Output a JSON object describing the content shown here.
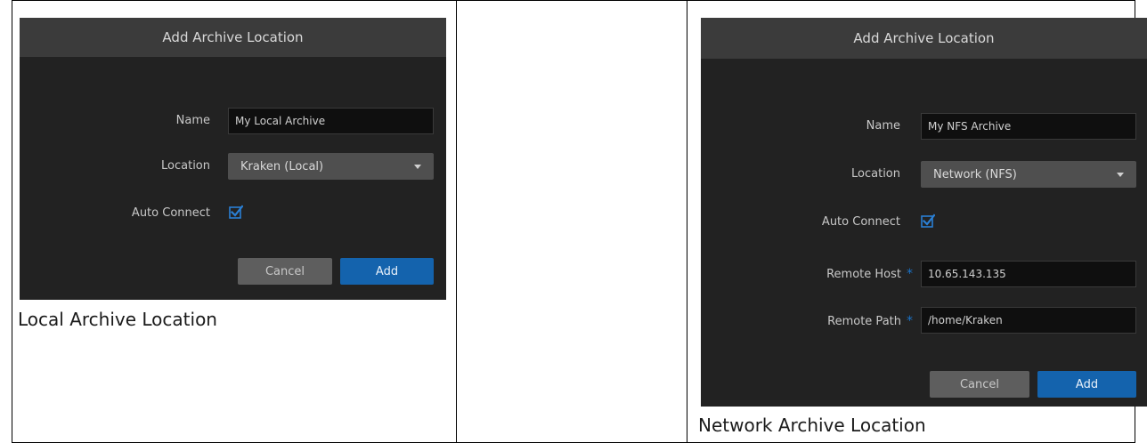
{
  "local": {
    "title": "Add Archive Location",
    "name_label": "Name",
    "name_value": "My Local Archive",
    "location_label": "Location",
    "location_value": "Kraken (Local)",
    "autoconnect_label": "Auto Connect",
    "autoconnect_checked": true,
    "cancel_label": "Cancel",
    "add_label": "Add",
    "caption": "Local Archive Location"
  },
  "network": {
    "title": "Add Archive Location",
    "name_label": "Name",
    "name_value": "My NFS Archive",
    "location_label": "Location",
    "location_value": "Network (NFS)",
    "autoconnect_label": "Auto Connect",
    "autoconnect_checked": true,
    "remote_host_label": "Remote Host",
    "remote_host_value": "10.65.143.135",
    "remote_path_label": "Remote Path",
    "remote_path_value": "/home/Kraken",
    "required_marker": "*",
    "cancel_label": "Cancel",
    "add_label": "Add",
    "caption": "Network Archive Location"
  },
  "colors": {
    "dialog_bg": "#222222",
    "header_bg": "#3b3b3b",
    "add_button": "#1463ad",
    "checkbox": "#2a7fd4"
  }
}
